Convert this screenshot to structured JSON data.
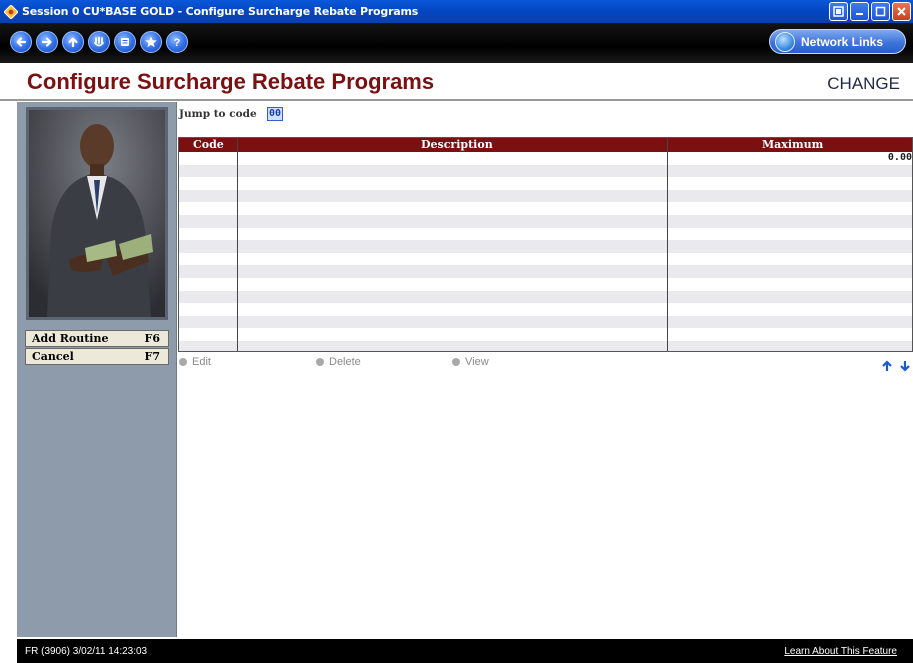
{
  "window": {
    "title": "Session 0 CU*BASE GOLD - Configure Surcharge Rebate Programs",
    "buttons": [
      "restore-icon",
      "minimize-icon",
      "maximize-icon",
      "close-icon"
    ]
  },
  "toolbar": {
    "nav_icons": [
      "back-icon",
      "forward-icon",
      "up-icon",
      "down-icon",
      "print-icon",
      "favorites-icon",
      "help-icon"
    ],
    "network_links_label": "Network Links"
  },
  "header": {
    "title": "Configure Surcharge Rebate Programs",
    "mode": "CHANGE"
  },
  "sidebar": {
    "fkeys": [
      {
        "label": "Add Routine",
        "key": "F6"
      },
      {
        "label": "Cancel",
        "key": "F7"
      }
    ]
  },
  "main": {
    "jump_label": "Jump to code",
    "jump_value": "00",
    "table": {
      "columns": [
        "Code",
        "Description",
        "Maximum"
      ],
      "rows": [
        {
          "code": "",
          "description": "",
          "maximum": "0.00"
        }
      ]
    },
    "actions": [
      "Edit",
      "Delete",
      "View"
    ]
  },
  "status": {
    "left": "FR (3906) 3/02/11 14:23:03",
    "right": "Learn About This Feature"
  },
  "colors": {
    "accent": "#7a1010",
    "titlebar": "#0346c0",
    "sidebar": "#8e9bab"
  }
}
